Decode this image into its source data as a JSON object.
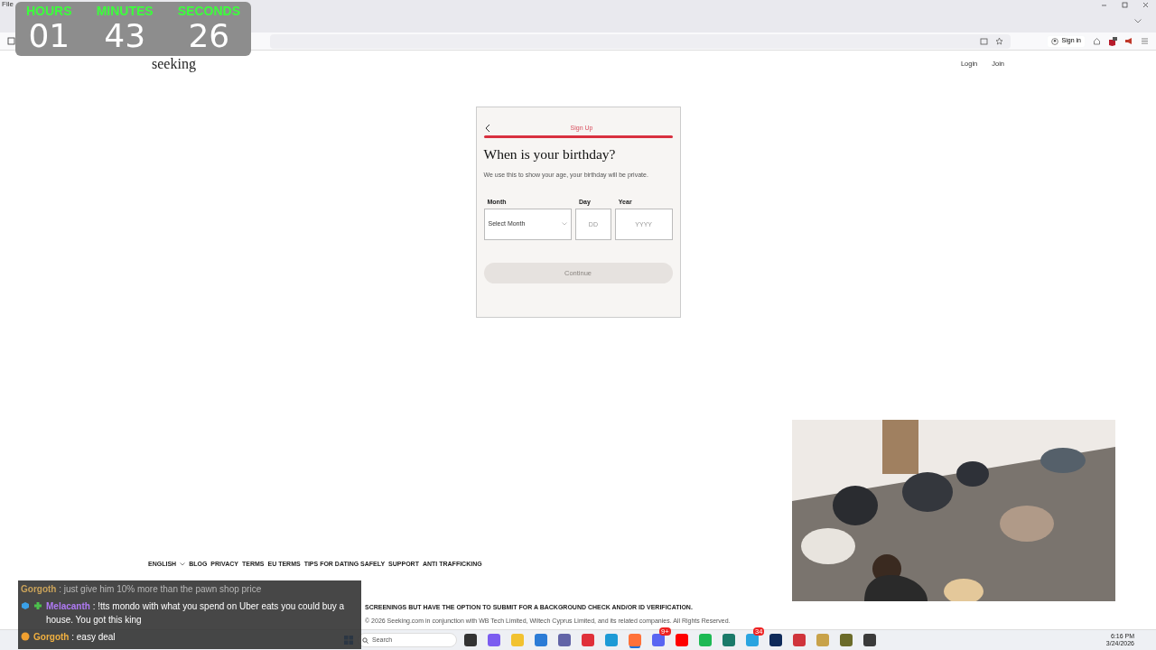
{
  "browser": {
    "menu": [
      "File"
    ],
    "sign_in": "Sign in"
  },
  "site": {
    "logo": "seeking",
    "nav": [
      "Login",
      "Join"
    ]
  },
  "form": {
    "step": "Sign Up",
    "progress": {
      "level": 1
    },
    "title": "When is your birthday?",
    "description": "We use this to show your age, your birthday will be private.",
    "fields": [
      {
        "label": "Month",
        "kind": "select",
        "placeholder": "Select Month"
      },
      {
        "label": "Day",
        "kind": "input",
        "placeholder": "DD"
      },
      {
        "label": "Year",
        "kind": "input",
        "placeholder": "YYYY"
      }
    ],
    "continue": {
      "label": "Continue",
      "disabled": true
    }
  },
  "footer": {
    "language": "ENGLISH",
    "links": [
      "BLOG",
      "PRIVACY",
      "TERMS",
      "EU TERMS",
      "TIPS FOR DATING SAFELY",
      "SUPPORT",
      "ANTI TRAFFICKING"
    ],
    "disclaimer": "SCREENINGS BUT HAVE THE OPTION TO SUBMIT FOR A BACKGROUND CHECK AND/OR ID VERIFICATION.",
    "copyright": "© 2026 Seeking.com in conjunction with WB Tech Limited, Wiltech Cyprus Limited, and its related companies. All Rights Reserved."
  },
  "timer": [
    {
      "label": "HOURS",
      "value": "01"
    },
    {
      "label": "MINUTES",
      "value": "43"
    },
    {
      "label": "SECONDS",
      "value": "26"
    }
  ],
  "chat": [
    {
      "user": "Gorgoth",
      "color": "#c9a25a",
      "text": ": just give him 10% more than the pawn shop price",
      "faded": true
    },
    {
      "user": "Melacanth",
      "color": "#b07af5",
      "text": ": !tts mondo with what you spend on Uber eats you could buy a house. You got this king",
      "faded": false,
      "badges": [
        {
          "kind": "cube"
        },
        {
          "kind": "gem"
        }
      ]
    },
    {
      "user": "Gorgoth",
      "color": "#f0b040",
      "text": ": easy deal",
      "faded": false,
      "badges": [
        {
          "kind": "dot"
        }
      ]
    }
  ],
  "taskbar": {
    "search": "Search",
    "time": "6:16 PM",
    "date": "3/24/2026",
    "apps": [
      {
        "color": "#333333",
        "selected": false
      },
      {
        "color": "#7b5cf0",
        "selected": false
      },
      {
        "color": "#f2c230",
        "selected": false
      },
      {
        "color": "#2b7bd6",
        "selected": false
      },
      {
        "color": "#6264a7",
        "selected": false
      },
      {
        "color": "#e0303a",
        "selected": false
      },
      {
        "color": "#1d9ad6",
        "selected": false
      },
      {
        "color": "#ff7139",
        "selected": true
      },
      {
        "color": "#5865f2",
        "selected": false,
        "badge": "9+"
      },
      {
        "color": "#ff0000",
        "selected": false
      },
      {
        "color": "#1db954",
        "selected": false
      },
      {
        "color": "#1a7a6a",
        "selected": false
      },
      {
        "color": "#2aa4e0",
        "selected": false,
        "badge": "34"
      },
      {
        "color": "#0e2a5a",
        "selected": false
      },
      {
        "color": "#d0343c",
        "selected": false
      },
      {
        "color": "#c8a24a",
        "selected": false
      },
      {
        "color": "#6b6b2a",
        "selected": false
      },
      {
        "color": "#3a3a3a",
        "selected": false
      }
    ]
  }
}
